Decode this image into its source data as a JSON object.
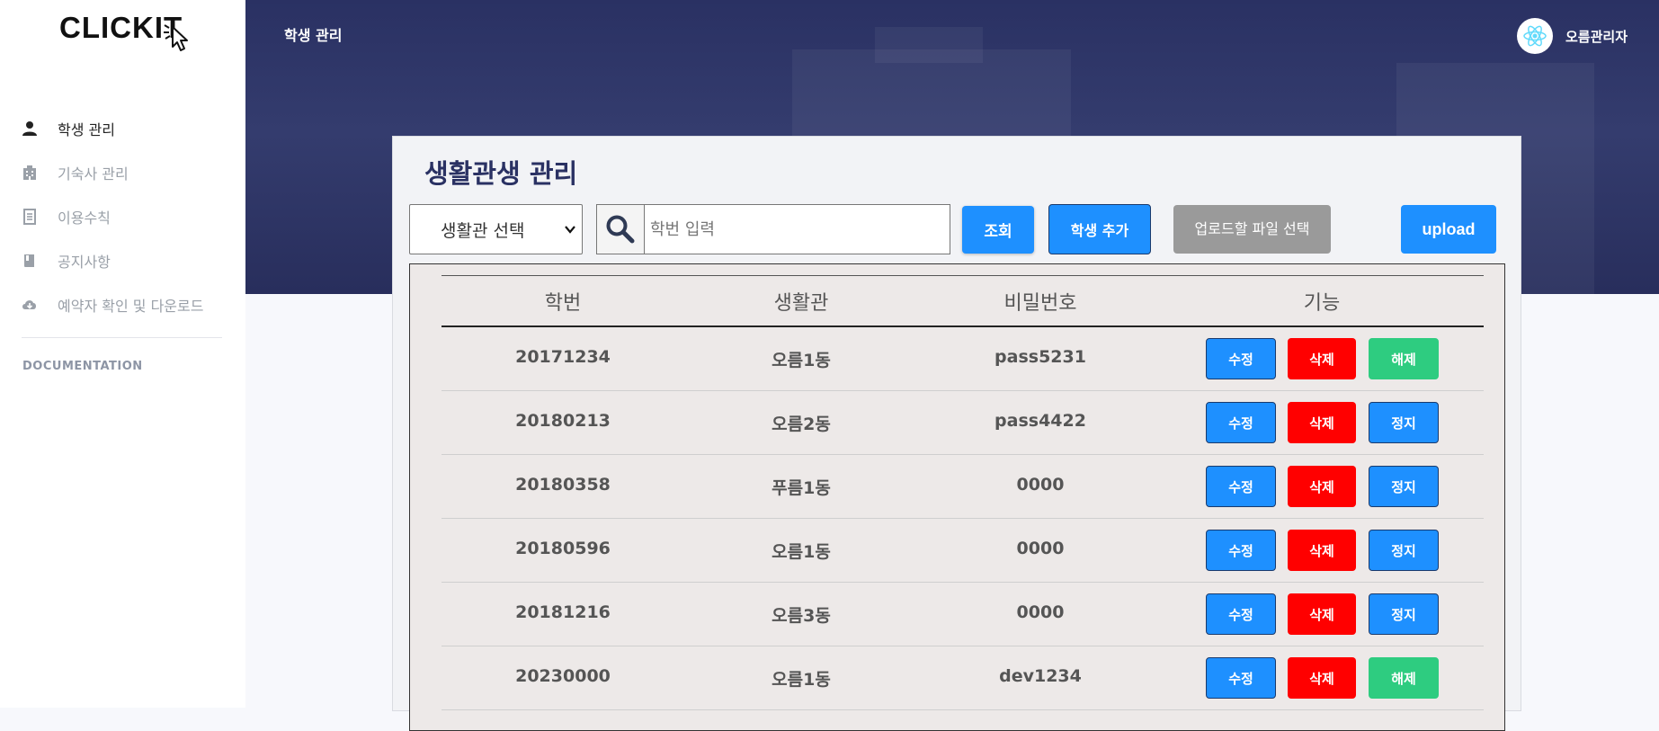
{
  "app": {
    "logo": "CLICKIT"
  },
  "sidebar": {
    "items": [
      {
        "label": "학생 관리",
        "icon": "person-icon",
        "active": true
      },
      {
        "label": "기숙사 관리",
        "icon": "building-icon",
        "active": false
      },
      {
        "label": "이용수칙",
        "icon": "document-icon",
        "active": false
      },
      {
        "label": "공지사항",
        "icon": "book-icon",
        "active": false
      },
      {
        "label": "예약자 확인 및 다운로드",
        "icon": "cloud-download-icon",
        "active": false
      }
    ],
    "doc_heading": "DOCUMENTATION"
  },
  "header": {
    "title": "학생 관리",
    "user_name": "오름관리자",
    "avatar_icon": "react-icon"
  },
  "main": {
    "title": "생활관생 관리",
    "dorm_select": {
      "value": "생활관 선택"
    },
    "search": {
      "placeholder": "학번 입력"
    },
    "buttons": {
      "query": "조회",
      "add_student": "학생 추가",
      "choose_file": "업로드할 파일 선택",
      "upload": "upload"
    },
    "table": {
      "headers": [
        "학번",
        "생활관",
        "비밀번호",
        "기능"
      ],
      "rows": [
        {
          "id": "20171234",
          "dorm": "오름1동",
          "password": "pass5231",
          "edit": "수정",
          "delete": "삭제",
          "action": "해제",
          "action_type": "release"
        },
        {
          "id": "20180213",
          "dorm": "오름2동",
          "password": "pass4422",
          "edit": "수정",
          "delete": "삭제",
          "action": "정지",
          "action_type": "suspend"
        },
        {
          "id": "20180358",
          "dorm": "푸름1동",
          "password": "0000",
          "edit": "수정",
          "delete": "삭제",
          "action": "정지",
          "action_type": "suspend"
        },
        {
          "id": "20180596",
          "dorm": "오름1동",
          "password": "0000",
          "edit": "수정",
          "delete": "삭제",
          "action": "정지",
          "action_type": "suspend"
        },
        {
          "id": "20181216",
          "dorm": "오름3동",
          "password": "0000",
          "edit": "수정",
          "delete": "삭제",
          "action": "정지",
          "action_type": "suspend"
        },
        {
          "id": "20230000",
          "dorm": "오름1동",
          "password": "dev1234",
          "edit": "수정",
          "delete": "삭제",
          "action": "해제",
          "action_type": "release"
        }
      ]
    }
  },
  "colors": {
    "primary": "#1e90ff",
    "danger": "#ff0000",
    "success": "#2ecc80",
    "banner": "#2a3163"
  }
}
